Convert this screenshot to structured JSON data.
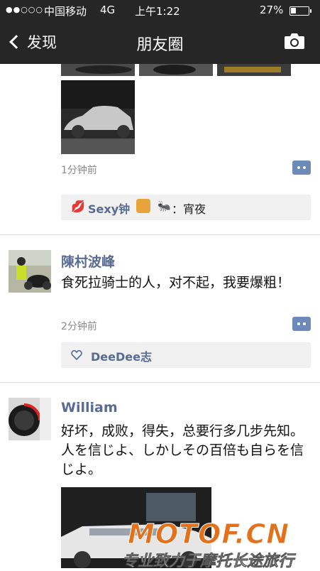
{
  "status_bar": {
    "signal": "●●○○○",
    "carrier": "中国移动",
    "network": "4G",
    "time": "上午1:22",
    "battery": "27%"
  },
  "nav": {
    "back_label": "发现",
    "title": "朋友圈"
  },
  "posts": [
    {
      "timestamp": "1分钟前",
      "likes_text": "Sexy钟",
      "like_extra": "：宵夜"
    },
    {
      "author": "陳村波峰",
      "text": "食死拉骑士的人，对不起，我要爆粗！",
      "timestamp": "2分钟前",
      "likes": "DeeDee志"
    },
    {
      "author": "William",
      "text": "好坏，成败，得失，总要行多几步先知。人を信じよ、しかしその百倍も自らを信じよ。"
    }
  ],
  "watermark": {
    "brand": "MOTOF.CN",
    "slogan": "专业致力于摩托长途旅行"
  }
}
